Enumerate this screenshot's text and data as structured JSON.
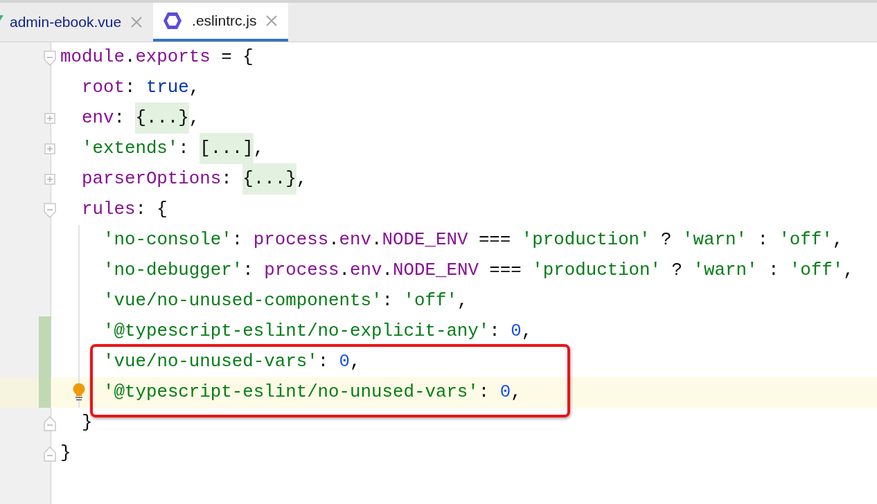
{
  "tabs": [
    {
      "label": "admin-ebook.vue",
      "selected": false,
      "kind": "vue"
    },
    {
      "label": ".eslintrc.js",
      "selected": true,
      "kind": "eslint"
    }
  ],
  "editor": {
    "lines": [
      {
        "kind": "opener",
        "changed": false,
        "current": false,
        "boxed": false,
        "tokens": [
          {
            "kind": "prop",
            "text": "module"
          },
          {
            "kind": "plain",
            "text": "."
          },
          {
            "kind": "prop",
            "text": "exports"
          },
          {
            "kind": "plain",
            "text": " = {"
          }
        ],
        "children": [
          {
            "changed": false,
            "current": false,
            "boxed": false,
            "tokens": [
              {
                "kind": "prop",
                "text": "root"
              },
              {
                "kind": "plain",
                "text": ": "
              },
              {
                "kind": "keyword",
                "text": "true"
              },
              {
                "kind": "plain",
                "text": ","
              }
            ]
          },
          {
            "kind": "collapsed",
            "changed": false,
            "current": false,
            "boxed": false,
            "tokens": [
              {
                "kind": "prop",
                "text": "env"
              },
              {
                "kind": "plain",
                "text": ": "
              },
              {
                "kind": "folded",
                "text": "{...}"
              },
              {
                "kind": "plain",
                "text": ","
              }
            ]
          },
          {
            "kind": "collapsed",
            "changed": false,
            "current": false,
            "boxed": false,
            "tokens": [
              {
                "kind": "string",
                "text": "'extends'"
              },
              {
                "kind": "plain",
                "text": ": "
              },
              {
                "kind": "folded",
                "text": "[...]"
              },
              {
                "kind": "plain",
                "text": ","
              }
            ]
          },
          {
            "kind": "collapsed",
            "changed": false,
            "current": false,
            "boxed": false,
            "tokens": [
              {
                "kind": "prop",
                "text": "parserOptions"
              },
              {
                "kind": "plain",
                "text": ": "
              },
              {
                "kind": "folded",
                "text": "{...}"
              },
              {
                "kind": "plain",
                "text": ","
              }
            ]
          },
          {
            "kind": "opener",
            "changed": false,
            "current": false,
            "boxed": false,
            "tokens": [
              {
                "kind": "prop",
                "text": "rules"
              },
              {
                "kind": "plain",
                "text": ": {"
              }
            ],
            "children": [
              {
                "changed": false,
                "current": false,
                "boxed": false,
                "tokens": [
                  {
                    "kind": "string",
                    "text": "'no-console'"
                  },
                  {
                    "kind": "plain",
                    "text": ": "
                  },
                  {
                    "kind": "prop",
                    "text": "process"
                  },
                  {
                    "kind": "plain",
                    "text": "."
                  },
                  {
                    "kind": "prop",
                    "text": "env"
                  },
                  {
                    "kind": "plain",
                    "text": "."
                  },
                  {
                    "kind": "prop",
                    "text": "NODE_ENV"
                  },
                  {
                    "kind": "plain",
                    "text": " === "
                  },
                  {
                    "kind": "string",
                    "text": "'production'"
                  },
                  {
                    "kind": "plain",
                    "text": " ? "
                  },
                  {
                    "kind": "string",
                    "text": "'warn'"
                  },
                  {
                    "kind": "plain",
                    "text": " : "
                  },
                  {
                    "kind": "string",
                    "text": "'off'"
                  },
                  {
                    "kind": "plain",
                    "text": ","
                  }
                ]
              },
              {
                "changed": false,
                "current": false,
                "boxed": false,
                "tokens": [
                  {
                    "kind": "string",
                    "text": "'no-debugger'"
                  },
                  {
                    "kind": "plain",
                    "text": ": "
                  },
                  {
                    "kind": "prop",
                    "text": "process"
                  },
                  {
                    "kind": "plain",
                    "text": "."
                  },
                  {
                    "kind": "prop",
                    "text": "env"
                  },
                  {
                    "kind": "plain",
                    "text": "."
                  },
                  {
                    "kind": "prop",
                    "text": "NODE_ENV"
                  },
                  {
                    "kind": "plain",
                    "text": " === "
                  },
                  {
                    "kind": "string",
                    "text": "'production'"
                  },
                  {
                    "kind": "plain",
                    "text": " ? "
                  },
                  {
                    "kind": "string",
                    "text": "'warn'"
                  },
                  {
                    "kind": "plain",
                    "text": " : "
                  },
                  {
                    "kind": "string",
                    "text": "'off'"
                  },
                  {
                    "kind": "plain",
                    "text": ","
                  }
                ]
              },
              {
                "changed": false,
                "current": false,
                "boxed": false,
                "tokens": [
                  {
                    "kind": "string",
                    "text": "'vue/no-unused-components'"
                  },
                  {
                    "kind": "plain",
                    "text": ": "
                  },
                  {
                    "kind": "string",
                    "text": "'off'"
                  },
                  {
                    "kind": "plain",
                    "text": ","
                  }
                ]
              },
              {
                "changed": true,
                "current": false,
                "boxed": false,
                "tokens": [
                  {
                    "kind": "string",
                    "text": "'@typescript-eslint/no-explicit-any'"
                  },
                  {
                    "kind": "plain",
                    "text": ": "
                  },
                  {
                    "kind": "number",
                    "text": "0"
                  },
                  {
                    "kind": "plain",
                    "text": ","
                  }
                ]
              },
              {
                "changed": true,
                "current": false,
                "boxed": true,
                "tokens": [
                  {
                    "kind": "string",
                    "text": "'vue/no-unused-vars'"
                  },
                  {
                    "kind": "plain",
                    "text": ": "
                  },
                  {
                    "kind": "number",
                    "text": "0"
                  },
                  {
                    "kind": "plain",
                    "text": ","
                  }
                ]
              },
              {
                "changed": true,
                "current": true,
                "boxed": true,
                "tokens": [
                  {
                    "kind": "string",
                    "text": "'@typescript-eslint/no-unused-vars'"
                  },
                  {
                    "kind": "plain",
                    "text": ": "
                  },
                  {
                    "kind": "number",
                    "text": "0"
                  },
                  {
                    "kind": "plain",
                    "text": ","
                  }
                ]
              }
            ]
          },
          {
            "kind": "closer",
            "changed": false,
            "current": false,
            "boxed": false,
            "tokens": [
              {
                "kind": "plain",
                "text": "}"
              }
            ]
          }
        ]
      },
      {
        "kind": "closer",
        "changed": false,
        "current": false,
        "boxed": false,
        "tokens": [
          {
            "kind": "plain",
            "text": "}"
          }
        ]
      }
    ]
  }
}
